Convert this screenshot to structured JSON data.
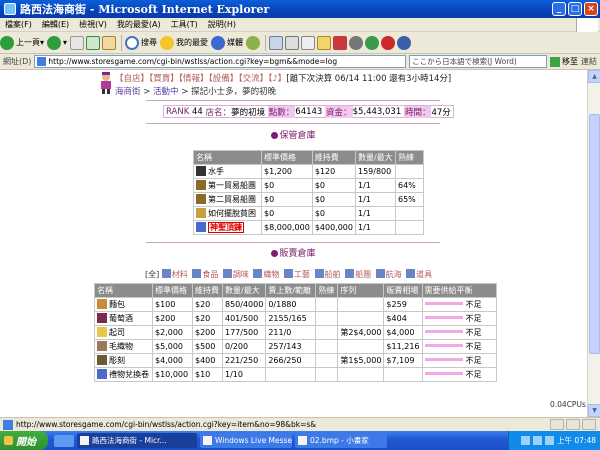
{
  "window": {
    "title": "路西法海商街 - Microsoft Internet Explorer",
    "min": "_",
    "max": "□",
    "close": "×"
  },
  "menu": [
    "檔案(F)",
    "編輯(E)",
    "檢視(V)",
    "我的最愛(A)",
    "工具(T)",
    "說明(H)"
  ],
  "toolbar": {
    "back": "上一頁",
    "search": "搜尋",
    "favorites": "我的最愛",
    "media": "媒體"
  },
  "address": {
    "label": "網址(D)",
    "url": "http://www.storesgame.com/cgi-bin/wstlss/action.cgi?key=bgm&&mode=log",
    "search_placeholder": "ここから日本語で検索(J Word)",
    "go": "移至",
    "links": "連結"
  },
  "nav": {
    "links": [
      "【自店】",
      "【買賣】",
      "【情報】",
      "【設備】",
      "【交流】",
      "【♪】"
    ],
    "deadline": "[離下次決算 06/14 11:00 還有3小時14分]",
    "crumb_home": "海商街",
    "crumb_active": "活動中",
    "crumb_tail": "> 探記小士多，夢的初晚"
  },
  "rank": {
    "rank_label": "RANK",
    "rank_value": "44",
    "shop_label": "店名：",
    "shop_name": "夢的初境",
    "points_label": "點數：",
    "points": "64143",
    "funds_label": "資金：",
    "funds": "$5,443,031",
    "time_label": "時間：",
    "time": "47分"
  },
  "storage": {
    "title": "保管倉庫",
    "headers": [
      "名稱",
      "標準價格",
      "維持費",
      "數量/最大",
      "熟練"
    ],
    "rows": [
      [
        "水手",
        "$1,200",
        "$120",
        "159/800",
        ""
      ],
      [
        "第一貿易船團",
        "$0",
        "$0",
        "1/1",
        "64%"
      ],
      [
        "第二貿易船團",
        "$0",
        "$0",
        "1/1",
        "65%"
      ],
      [
        "如何擺脫貧困",
        "$0",
        "$0",
        "1/1",
        ""
      ],
      [
        "神聖頂鍊",
        "$8,000,000",
        "$400,000",
        "1/1",
        ""
      ]
    ]
  },
  "sales": {
    "title": "販賣倉庫",
    "filter_all": "[全]",
    "filters": [
      "材料",
      "食品",
      "調味",
      "織物",
      "工藝",
      "船舶",
      "船團",
      "航海",
      "道具"
    ],
    "headers": [
      "名稱",
      "標準價格",
      "維持費",
      "數量/最大",
      "賣上數/範離",
      "熟練",
      "序列",
      "販賣相場",
      "需要供給平衡"
    ],
    "rows": [
      [
        "麵包",
        "$100",
        "$20",
        "850/4000",
        "0/1880",
        "",
        "",
        "$259",
        "不足"
      ],
      [
        "葡萄酒",
        "$200",
        "$20",
        "401/500",
        "2155/165",
        "",
        "",
        "$404",
        "不足"
      ],
      [
        "起司",
        "$2,000",
        "$200",
        "177/500",
        "211/0",
        "",
        "第2$4,000",
        "$4,000",
        "不足"
      ],
      [
        "毛織物",
        "$5,000",
        "$500",
        "0/200",
        "257/143",
        "",
        "",
        "$11,216",
        "不足"
      ],
      [
        "彫刻",
        "$4,000",
        "$400",
        "221/250",
        "266/250",
        "",
        "第1$5,000",
        "$7,109",
        "不足"
      ],
      [
        "禮物兌換卷",
        "$10,000",
        "$10",
        "1/10",
        "",
        "",
        "",
        "",
        "不足"
      ]
    ]
  },
  "cpu": "0.04CPUs",
  "status": {
    "url": "http://www.storesgame.com/cgi-bin/wstlss/action.cgi?key=item&no=98&bk=s&"
  },
  "taskbar": {
    "start": "開始",
    "tasks": [
      "路西法海商街 - Micr...",
      "Windows Live Messen...",
      "02.bmp - 小畫家"
    ],
    "clock": "上午 07:48"
  }
}
